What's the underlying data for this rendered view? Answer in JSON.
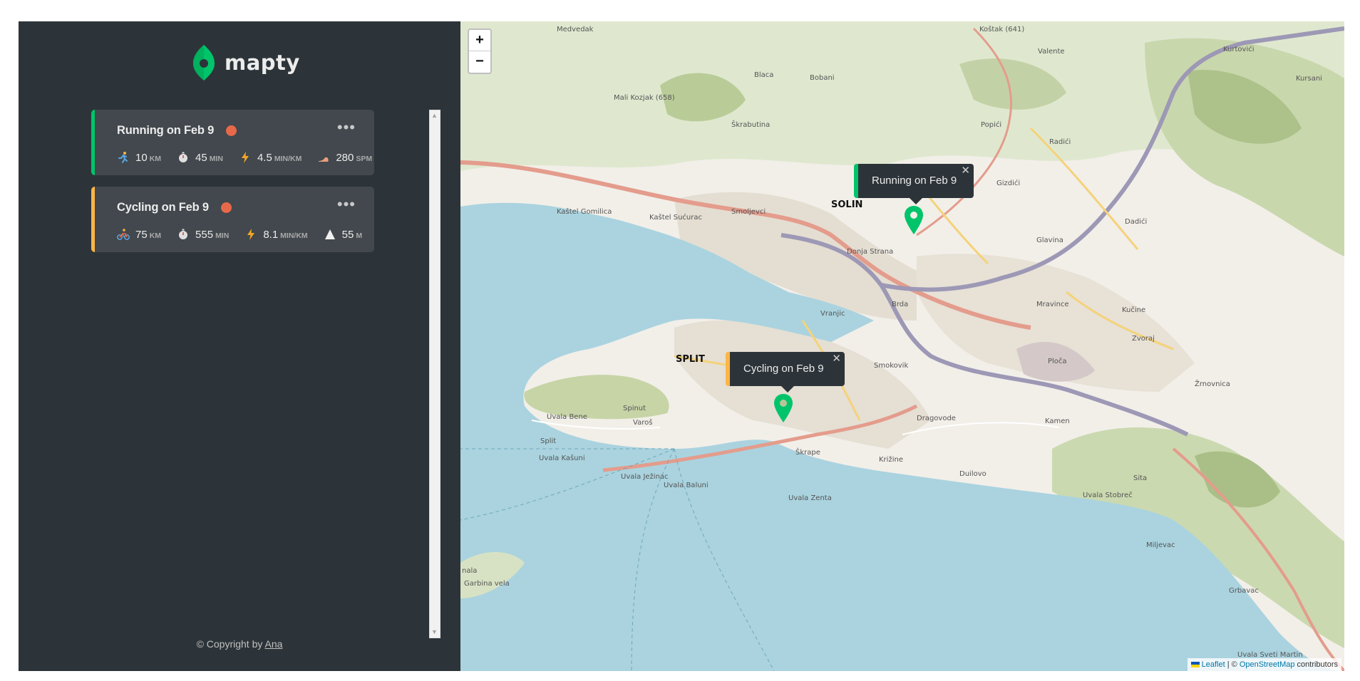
{
  "app": {
    "name": "mapty"
  },
  "workouts": [
    {
      "type": "running",
      "title": "Running on Feb 9",
      "details": [
        {
          "icon": "running-icon",
          "value": "10",
          "unit": "KM"
        },
        {
          "icon": "stopwatch-icon",
          "value": "45",
          "unit": "MIN"
        },
        {
          "icon": "lightning-icon",
          "value": "4.5",
          "unit": "MIN/KM"
        },
        {
          "icon": "footprint-icon",
          "value": "280",
          "unit": "SPM"
        }
      ]
    },
    {
      "type": "cycling",
      "title": "Cycling on Feb 9",
      "details": [
        {
          "icon": "cycling-icon",
          "value": "75",
          "unit": "KM"
        },
        {
          "icon": "stopwatch-icon",
          "value": "555",
          "unit": "MIN"
        },
        {
          "icon": "lightning-icon",
          "value": "8.1",
          "unit": "MIN/KM"
        },
        {
          "icon": "mountain-icon",
          "value": "55",
          "unit": "M"
        }
      ]
    }
  ],
  "workout_menu": "•••",
  "footer": {
    "copyright_text": "© Copyright by ",
    "author": "Ana"
  },
  "map": {
    "zoom_in": "+",
    "zoom_out": "−",
    "popups": [
      {
        "type": "running",
        "text": "Running on Feb 9"
      },
      {
        "type": "cycling",
        "text": "Cycling on Feb 9"
      }
    ],
    "popup_close": "✕",
    "labels": {
      "solin": "SOLIN",
      "split": "SPLIT",
      "medvedak": "Medvedak",
      "blaca": "Blaca",
      "bobani": "Bobani",
      "mali_kozjak": "Mali Kozjak (658)",
      "skrabutina": "Škrabutina",
      "kastel_gomilica": "Kaštel Gomilica",
      "kastel_sucurac": "Kaštel Sućurac",
      "smoljevci": "Smoljevci",
      "donja_strana": "Donja Strana",
      "vranjic": "Vranjic",
      "brda": "Brda",
      "smokovik": "Smokovik",
      "dragovode": "Dragovode",
      "kamen": "Kamen",
      "skrape": "Škrape",
      "krizine": "Križine",
      "duilovo": "Duilovo",
      "uvala_bene": "Uvala Bene",
      "uvala_kasuni": "Uvala Kašuni",
      "uvala_jezinac": "Uvala Ježinac",
      "uvala_baluni": "Uvala Baluni",
      "uvala_zenta": "Uvala Zenta",
      "uvala_stobrec": "Uvala Stobreč",
      "mravince": "Mravince",
      "kucine": "Kučine",
      "zvoraj": "Zvoraj",
      "zrnovnica": "Žrnovnica",
      "ploca": "Ploča",
      "sita": "Sita",
      "miljevac": "Miljevac",
      "glavina": "Glavina",
      "dadici": "Dadići",
      "radici": "Radići",
      "kostak": "Koštak (641)",
      "valente": "Valente",
      "kurtovici": "Kurtovići",
      "kursani": "Kursani",
      "grbavac": "Grbavac",
      "uvala_sveti_martin": "Uvala Sveti Martin",
      "garbina_vela": "Garbina vela",
      "nala": "nala",
      "spinut": "Spinut",
      "varos": "Varoš",
      "split_small": "Split",
      "gizdici": "Gizdići",
      "popici": "Popići"
    },
    "attribution": {
      "leaflet": "Leaflet",
      "sep": " | © ",
      "osm": "OpenStreetMap",
      "contributors": " contributors"
    }
  },
  "colors": {
    "running": "#00c46a",
    "cycling": "#ffb545",
    "sidebar": "#2d3439",
    "card": "#42484d",
    "sea": "#aad3df"
  }
}
